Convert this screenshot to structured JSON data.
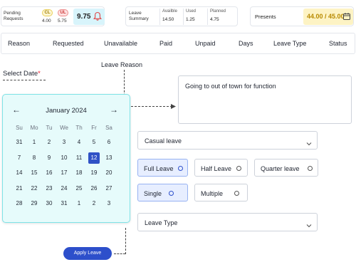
{
  "summary": {
    "pending_label": "Pending Requests",
    "cl_label": "CL",
    "ul_label": "UL",
    "cl_value": "4.00",
    "ul_value": "5.75",
    "pending_total": "9.75",
    "leave_summary_label": "Leave Summary",
    "available_label": "Availble",
    "available_value": "14.50",
    "used_label": "Used",
    "used_value": "1.25",
    "planned_label": "Planned",
    "planned_value": "4.75",
    "presents_label": "Presents",
    "presents_value": "44.00 / 45.00"
  },
  "table": {
    "headers": [
      "Reason",
      "Requested",
      "Unavailable",
      "Paid",
      "Unpaid",
      "Days",
      "Leave Type",
      "Status"
    ]
  },
  "form": {
    "select_date_label": "Select Date",
    "required_mark": "*",
    "leave_reason_label": "Leave Reason",
    "reason_text": "Going to out of town for function",
    "leave_category": "Casual leave",
    "duration_options": [
      "Full Leave",
      "Half Leave",
      "Quarter leave"
    ],
    "selected_duration": "Full Leave",
    "day_options": [
      "Single",
      "Multiple"
    ],
    "selected_day": "Single",
    "leave_type_placeholder": "Leave Type",
    "apply_label": "Apply Leave"
  },
  "calendar": {
    "month_label": "January 2024",
    "prev_glyph": "←",
    "next_glyph": "→",
    "weekdays": [
      "Su",
      "Mo",
      "Tu",
      "We",
      "Th",
      "Fr",
      "Sa"
    ],
    "weeks": [
      [
        "31",
        "1",
        "2",
        "3",
        "4",
        "5",
        "6"
      ],
      [
        "7",
        "8",
        "9",
        "10",
        "11",
        "12",
        "13"
      ],
      [
        "14",
        "15",
        "16",
        "17",
        "18",
        "19",
        "20"
      ],
      [
        "21",
        "22",
        "23",
        "24",
        "25",
        "26",
        "27"
      ],
      [
        "28",
        "29",
        "30",
        "31",
        "1",
        "2",
        "3"
      ]
    ],
    "selected_day": "12",
    "selected_color": "#2f52c6"
  },
  "icons": {
    "bell": "bell-icon",
    "calendar": "calendar-icon",
    "chevron": "chevron-down-icon"
  }
}
